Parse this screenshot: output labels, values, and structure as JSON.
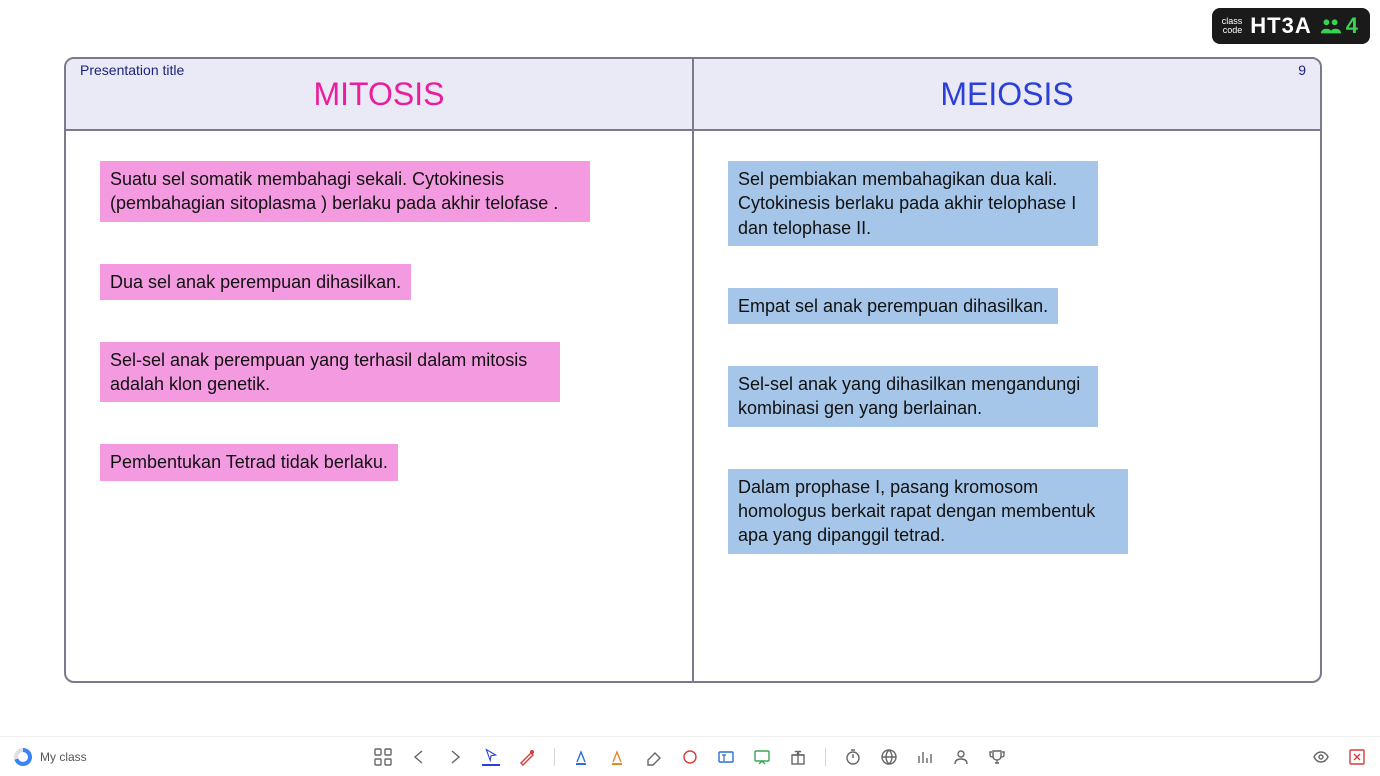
{
  "badge": {
    "label_top": "class",
    "label_bottom": "code",
    "code": "HT3A",
    "count": "4"
  },
  "slide": {
    "pres_title": "Presentation title",
    "page_num": "9",
    "left_heading": "MITOSIS",
    "right_heading": "MEIOSIS",
    "left_blocks": [
      "Suatu sel somatik membahagi sekali. Cytokinesis (pembahagian sitoplasma ) berlaku pada akhir telofase .",
      "Dua sel anak perempuan dihasilkan.",
      "Sel-sel anak perempuan yang terhasil dalam mitosis adalah klon genetik.",
      "Pembentukan Tetrad tidak berlaku."
    ],
    "right_blocks": [
      "Sel pembiakan membahagikan dua kali. Cytokinesis berlaku pada akhir telophase I dan telophase II.",
      "Empat sel anak perempuan dihasilkan.",
      "Sel-sel anak yang dihasilkan mengandungi kombinasi gen yang berlainan.",
      "Dalam prophase I, pasang kromosom homologus berkait rapat dengan membentuk apa yang dipanggil tetrad."
    ]
  },
  "footer": {
    "brand": "My class"
  }
}
